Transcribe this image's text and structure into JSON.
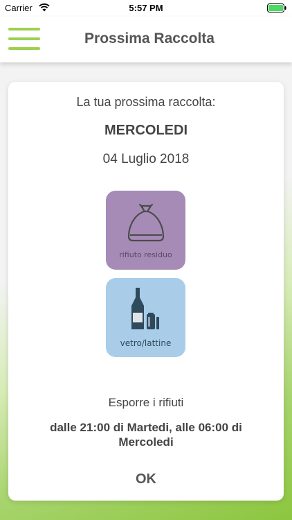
{
  "status_bar": {
    "carrier": "Carrier",
    "time": "5:57 PM",
    "icons": [
      "wifi-icon",
      "battery-icon"
    ],
    "battery_color": "#4cd964"
  },
  "nav": {
    "title": "Prossima Raccolta",
    "menu_icon": "hamburger-menu-icon",
    "accent_color": "#9ed04f"
  },
  "card": {
    "intro": "La tua prossima raccolta:",
    "day": "MERCOLEDI",
    "date": "04 Luglio 2018",
    "bins": [
      {
        "label": "rifiuto residuo",
        "icon": "garbage-bag-icon",
        "color": "#a68bb7"
      },
      {
        "label": "vetro/lattine",
        "icon": "bottle-can-icon",
        "color": "#a9cde9"
      }
    ],
    "expose_title": "Esporre i rifiuti",
    "expose_time": "dalle 21:00 di Martedi, alle 06:00 di Mercoledi",
    "ok_label": "OK"
  }
}
